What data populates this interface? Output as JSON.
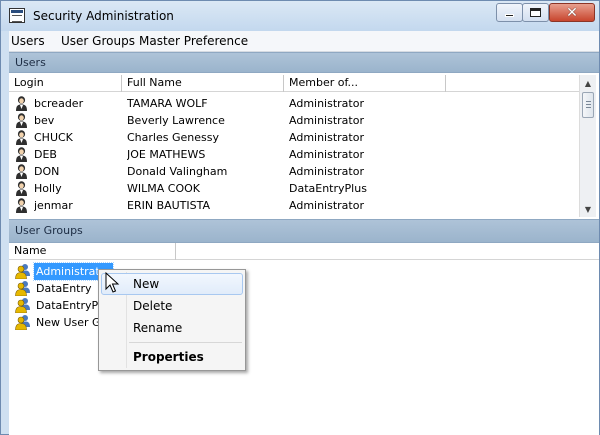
{
  "window": {
    "title": "Security Administration"
  },
  "menubar": {
    "items": [
      "Users",
      "User Groups",
      "Master Preference"
    ]
  },
  "users_section": {
    "title": "Users",
    "columns": [
      "Login",
      "Full Name",
      "Member of..."
    ],
    "rows": [
      {
        "login": "bcreader",
        "full_name": "TAMARA WOLF",
        "member_of": "Administrator"
      },
      {
        "login": "bev",
        "full_name": "Beverly Lawrence",
        "member_of": "Administrator"
      },
      {
        "login": "CHUCK",
        "full_name": "Charles Genessy",
        "member_of": "Administrator"
      },
      {
        "login": "DEB",
        "full_name": "JOE MATHEWS",
        "member_of": "Administrator"
      },
      {
        "login": "DON",
        "full_name": "Donald Valingham",
        "member_of": "Administrator"
      },
      {
        "login": "Holly",
        "full_name": "WILMA COOK",
        "member_of": "DataEntryPlus"
      },
      {
        "login": "jenmar",
        "full_name": "ERIN BAUTISTA",
        "member_of": "Administrator"
      }
    ]
  },
  "groups_section": {
    "title": "User Groups",
    "columns": [
      "Name"
    ],
    "rows": [
      {
        "name": "Administrator",
        "selected": true
      },
      {
        "name": "DataEntry",
        "selected": false
      },
      {
        "name": "DataEntryPlus",
        "selected": false
      },
      {
        "name": "New User Gr",
        "selected": false
      }
    ]
  },
  "context_menu": {
    "items": [
      {
        "label": "New",
        "hover": true,
        "bold": false
      },
      {
        "label": "Delete",
        "hover": false,
        "bold": false
      },
      {
        "label": "Rename",
        "hover": false,
        "bold": false
      },
      {
        "label": "Properties",
        "hover": false,
        "bold": true
      }
    ]
  },
  "icons": {
    "user": "user-icon",
    "group": "user-group-icon",
    "app": "app-window-icon"
  },
  "colors": {
    "selection": "#3399ff",
    "section_header": "#a7bed6",
    "close_button": "#c8452d"
  }
}
